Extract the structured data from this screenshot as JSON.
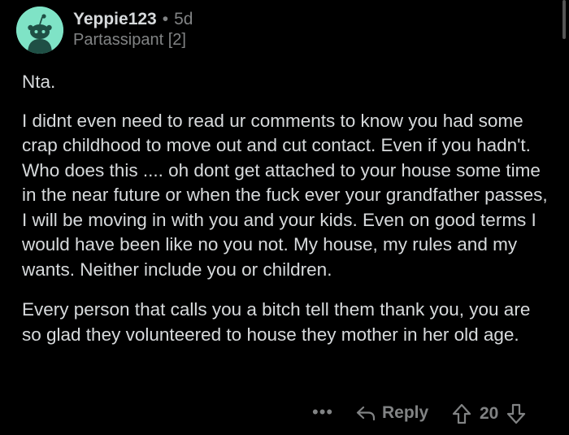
{
  "comment": {
    "author": "Yeppie123",
    "separator": "•",
    "age": "5d",
    "flair": "Partassipant [2]",
    "paragraphs": [
      "Nta.",
      "I didnt even need to read ur comments to know you had some crap childhood to move out and cut contact. Even if you hadn't. Who does this .... oh dont get attached to your house some time in the near future or when the fuck ever your grandfather passes, I will be moving in with you and your kids. Even on good terms I would have been like no you not. My house, my rules and my wants. Neither include you or children.",
      "Every person that calls you a bitch tell them thank you, you are so glad they volunteered to house they mother in her old age."
    ]
  },
  "actions": {
    "more_label": "•••",
    "reply_label": "Reply",
    "vote_count": "20"
  },
  "colors": {
    "background": "#000000",
    "text": "#d7dadc",
    "muted": "#818384",
    "avatar": "#7fe3c6"
  },
  "icons": {
    "avatar": "snoo-avatar-icon",
    "reply": "reply-arrow-icon",
    "upvote": "upvote-arrow-icon",
    "downvote": "downvote-arrow-icon"
  }
}
